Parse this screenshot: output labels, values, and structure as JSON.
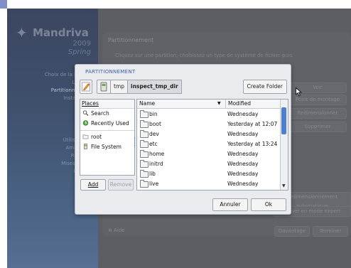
{
  "installer": {
    "brand": "Mandriva",
    "edition_line1": "2009",
    "edition_line2": "Spring",
    "steps_group1": [
      "Choix de la langue",
      "Licence",
      "Partitionnement",
      "Installation"
    ],
    "steps_group2": [
      "Utilisateurs",
      "Amorçage",
      "Résumé",
      "Mises à jour",
      "Quitter"
    ],
    "page_title": "Partitionnement",
    "page_text": "Cliquez sur une partition, choisissez un type de système de fichier puis",
    "right_buttons": [
      "Voir",
      "Point de montage",
      "Redimensionner",
      "Supprimer"
    ],
    "lower_buttons": [
      "Redimensionnement automatique",
      "Passer en mode expert"
    ],
    "help_label": "Aide",
    "advanced_label": "Davantage",
    "finish_label": "Terminer"
  },
  "dialog": {
    "title": "PARTITIONNEMENT",
    "path_segments": [
      "tmp",
      "inspect_tmp_dir"
    ],
    "create_folder_label": "Create Folder",
    "places_header": "Places",
    "places": [
      {
        "label": "Search",
        "icon": "search-icon"
      },
      {
        "label": "Recently Used",
        "icon": "recent-icon"
      },
      {
        "label": "root",
        "icon": "folder-icon"
      },
      {
        "label": "File System",
        "icon": "drive-icon"
      }
    ],
    "add_label": "Add",
    "remove_label": "Remove",
    "columns": {
      "name": "Name",
      "modified": "Modified"
    },
    "files": [
      {
        "name": "bin",
        "modified": "Wednesday"
      },
      {
        "name": "boot",
        "modified": "Yesterday at 12:07"
      },
      {
        "name": "dev",
        "modified": "Wednesday"
      },
      {
        "name": "etc",
        "modified": "Yesterday at 13:24"
      },
      {
        "name": "home",
        "modified": "Wednesday"
      },
      {
        "name": "initrd",
        "modified": "Wednesday"
      },
      {
        "name": "lib",
        "modified": "Wednesday"
      },
      {
        "name": "live",
        "modified": "Wednesday"
      }
    ],
    "cancel_label": "Annuler",
    "ok_label": "Ok"
  }
}
